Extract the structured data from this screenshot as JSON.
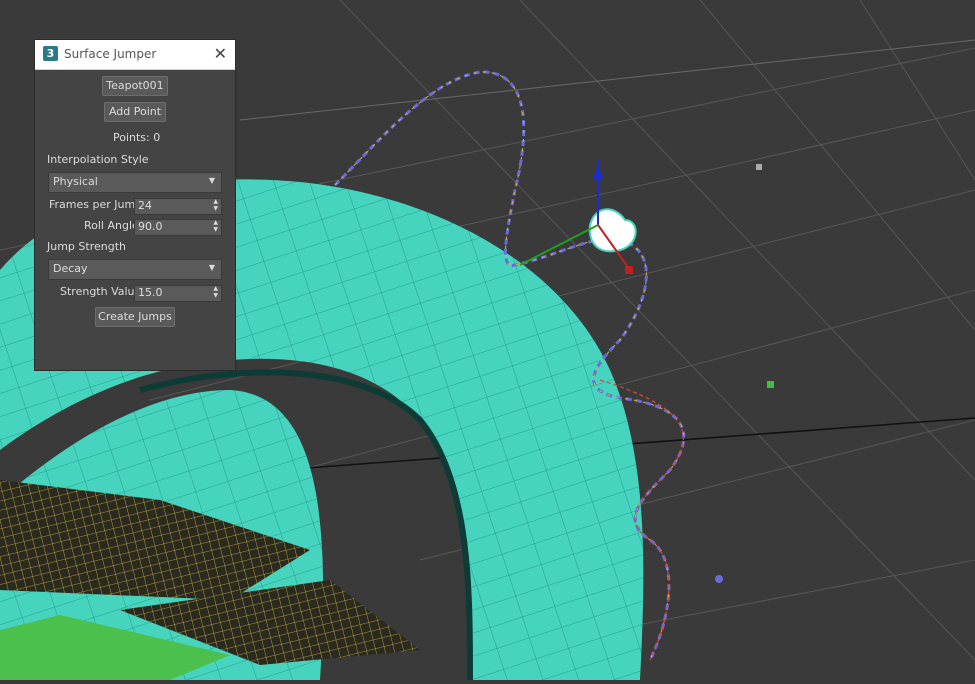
{
  "dialog": {
    "title": "Surface Jumper",
    "app_icon_text": "3",
    "close_glyph": "✕",
    "object_button": "Teapot001",
    "add_point_button": "Add Point",
    "points_label": "Points: 0",
    "interp_heading": "Interpolation Style",
    "interp_value": "Physical",
    "frames_label": "Frames per Jump",
    "frames_value": "24",
    "roll_label": "Roll Angle",
    "roll_value": "90.0",
    "strength_heading": "Jump Strength",
    "strength_style_value": "Decay",
    "strength_value_label": "Strength Value",
    "strength_value": "15.0",
    "create_button": "Create Jumps"
  },
  "viewport": {
    "background": "#3a3a3a",
    "torus_color": "#46d4bf",
    "grid_color": "#5a5a5a",
    "plane_color": "#d9b54a",
    "green_plane": "#4cc04c",
    "path_color": "#6b6bd8"
  }
}
